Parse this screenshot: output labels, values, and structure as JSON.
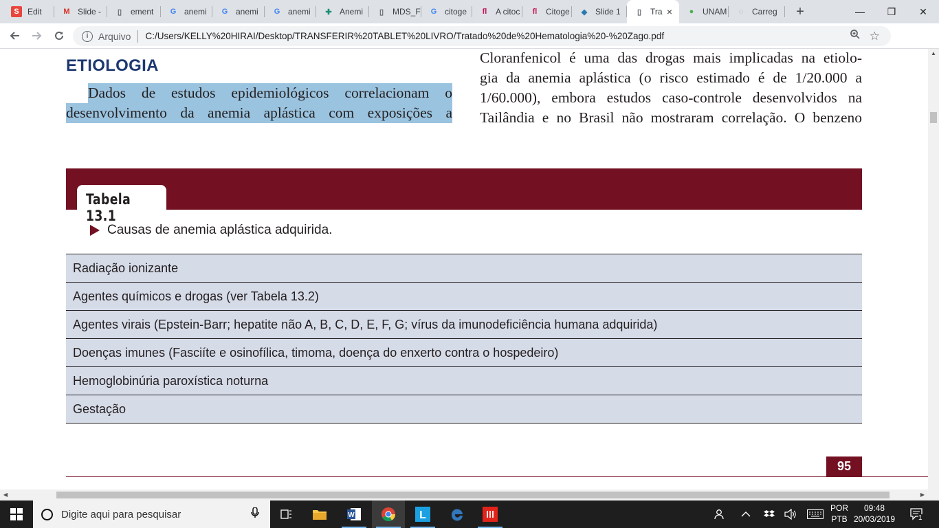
{
  "browser": {
    "tabs": [
      {
        "label": "Edit",
        "icon": "slides-s-icon",
        "color": "#e8453c",
        "active": false
      },
      {
        "label": "Slide -",
        "icon": "gmail-icon",
        "color": "#d93025",
        "active": false
      },
      {
        "label": "ement",
        "icon": "document-icon",
        "color": "#5f6368",
        "active": false
      },
      {
        "label": "anemi",
        "icon": "google-icon",
        "color": "#4285f4",
        "active": false
      },
      {
        "label": "anemi",
        "icon": "google-icon",
        "color": "#4285f4",
        "active": false
      },
      {
        "label": "anemi",
        "icon": "google-icon",
        "color": "#4285f4",
        "active": false
      },
      {
        "label": "Anemi",
        "icon": "medical-icon",
        "color": "#1a8e73",
        "active": false
      },
      {
        "label": "MDS_F",
        "icon": "document-icon",
        "color": "#5f6368",
        "active": false
      },
      {
        "label": "citoge",
        "icon": "google-icon",
        "color": "#4285f4",
        "active": false
      },
      {
        "label": "A citoc",
        "icon": "fl-icon",
        "color": "#c2185b",
        "active": false
      },
      {
        "label": "Citoge",
        "icon": "fl-icon",
        "color": "#c2185b",
        "active": false
      },
      {
        "label": "Slide 1",
        "icon": "slides-hat-icon",
        "color": "#2a7ab0",
        "active": false
      },
      {
        "label": "Tra",
        "icon": "document-icon",
        "color": "#5f6368",
        "active": true
      },
      {
        "label": "UNAM",
        "icon": "unam-icon",
        "color": "#4caf50",
        "active": false
      },
      {
        "label": "Carreg",
        "icon": "loading-icon",
        "color": "#9aa0a6",
        "active": false
      }
    ],
    "new_tab": "+",
    "close_tab": "×",
    "window_controls": {
      "minimize": "—",
      "maximize": "❐",
      "close": "✕"
    },
    "address": {
      "scheme_label": "Arquivo",
      "url": "C:/Users/KELLY%20HIRAI/Desktop/TRANSFERIR%20TABLET%20LIVRO/Tratado%20de%20Hematologia%20-%20Zago.pdf",
      "info_glyph": "i"
    }
  },
  "pdf": {
    "heading": "ETIOLOGIA",
    "left_lines": [
      "Dados de estudos epidemiológicos correlacionam o",
      "desenvolvimento da anemia aplástica com exposições a"
    ],
    "right_lines": [
      "Cloranfenicol é uma das drogas mais implicadas na etiolo-",
      "gia da anemia aplástica (o risco estimado é de 1/20.000 a",
      "1/60.000), embora estudos caso-controle desenvolvidos na",
      "Tailândia e no Brasil não mostraram correlação. O benzeno"
    ],
    "table_label": "Tabela 13.1",
    "table_caption": "Causas de anemia aplástica adquirida.",
    "table_rows": [
      "Radiação ionizante",
      "Agentes químicos e drogas (ver Tabela 13.2)",
      "Agentes virais (Epstein-Barr; hepatite não A, B, C, D, E, F, G; vírus da imunodeficiência humana adquirida)",
      "Doenças imunes (Fasciíte e osinofílica, timoma, doença do enxerto contra o hospedeiro)",
      "Hemoglobinúria paroxística noturna",
      "Gestação"
    ],
    "page_number": "95",
    "highlight_color": "#9ac3df",
    "accent_color": "#731022"
  },
  "taskbar": {
    "search_placeholder": "Digite aqui para pesquisar",
    "lang_line1": "POR",
    "lang_line2": "PTB",
    "time": "09:48",
    "date": "20/03/2019",
    "notification_count": "1"
  }
}
